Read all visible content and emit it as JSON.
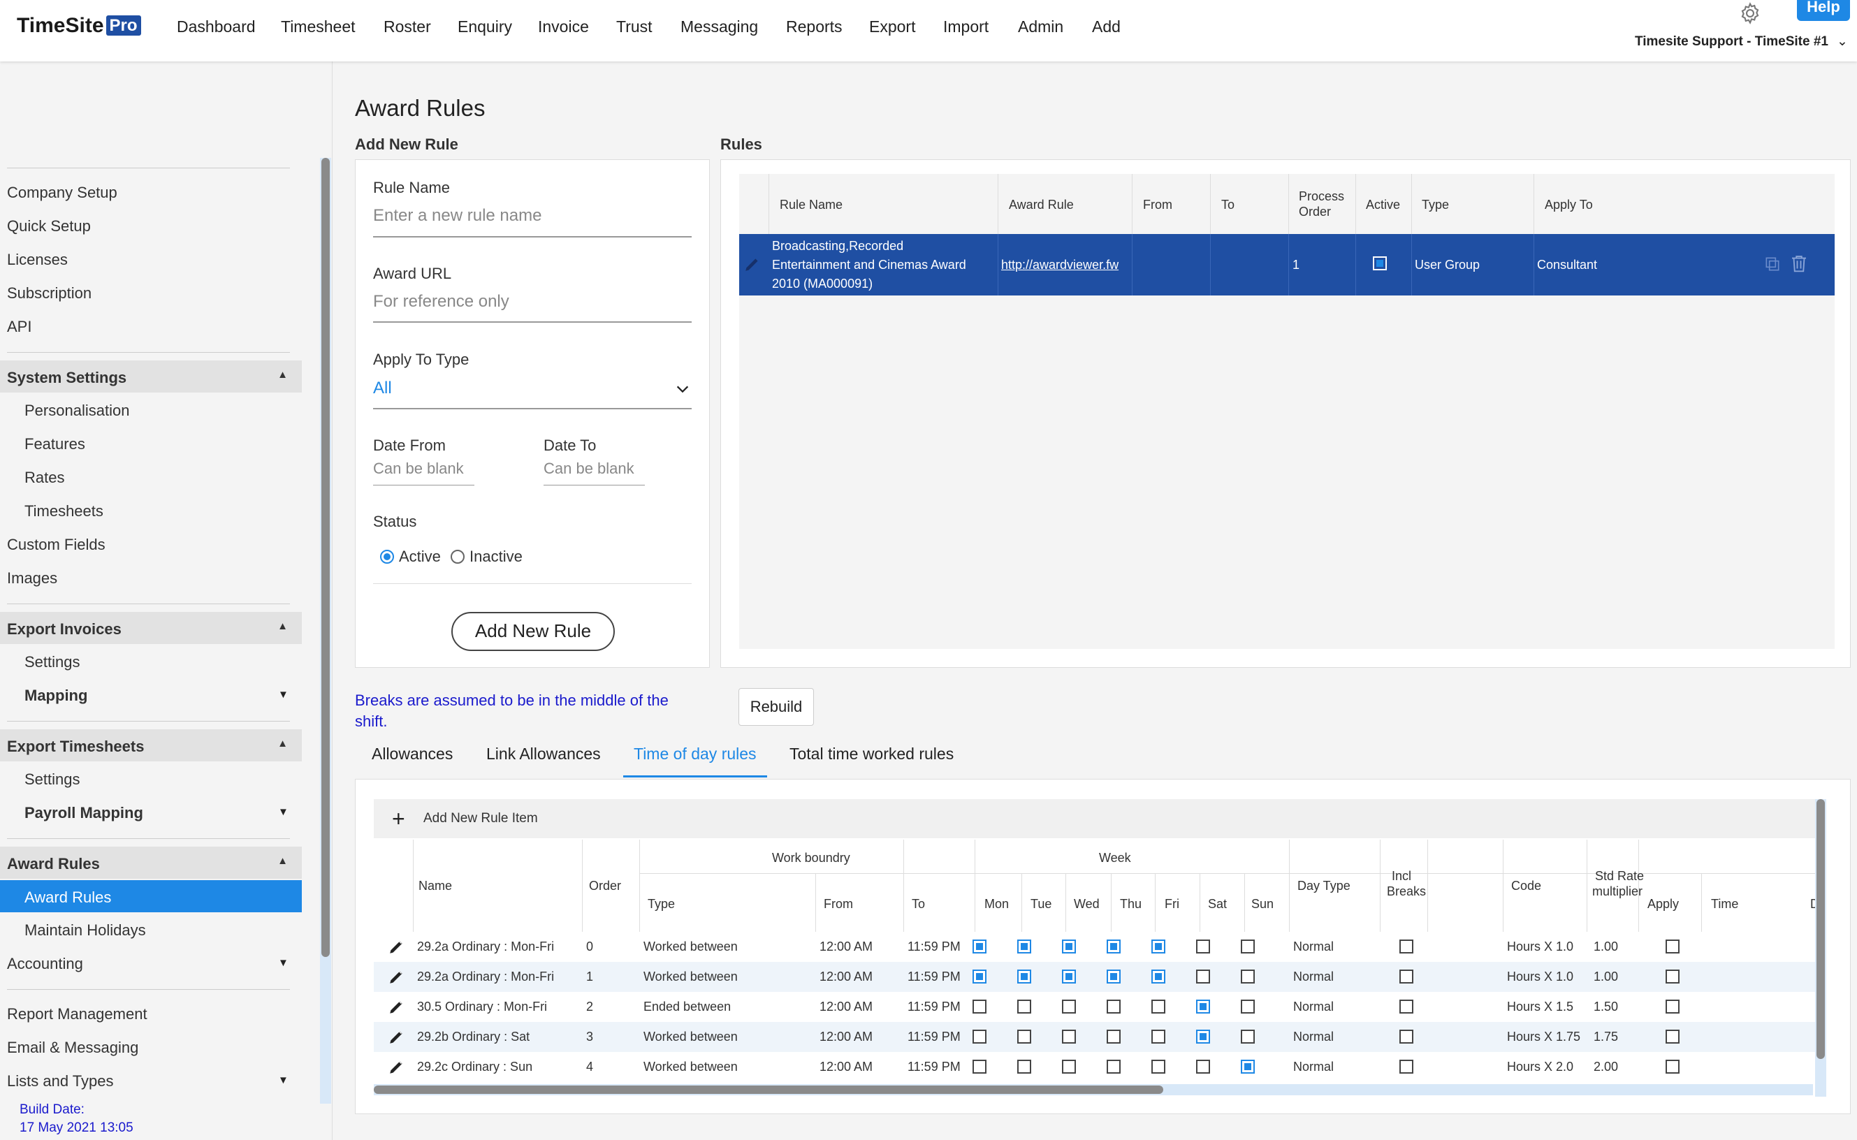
{
  "app": {
    "logo_text": "TimeSite",
    "logo_badge": "Pro",
    "help_label": "Help",
    "account": "Timesite Support - TimeSite #1"
  },
  "nav": [
    "Dashboard",
    "Timesheet",
    "Roster",
    "Enquiry",
    "Invoice",
    "Trust",
    "Messaging",
    "Reports",
    "Export",
    "Import",
    "Admin",
    "Add"
  ],
  "sidebar": {
    "group1": [
      "Company Setup",
      "Quick Setup",
      "Licenses",
      "Subscription",
      "API"
    ],
    "system_settings": {
      "title": "System Settings",
      "items": [
        "Personalisation",
        "Features",
        "Rates",
        "Timesheets"
      ]
    },
    "group2": [
      "Custom Fields",
      "Images"
    ],
    "export_invoices": {
      "title": "Export Invoices",
      "items": [
        "Settings",
        "Mapping"
      ]
    },
    "export_timesheets": {
      "title": "Export Timesheets",
      "items": [
        "Settings",
        "Payroll Mapping"
      ]
    },
    "award_rules": {
      "title": "Award Rules",
      "items": [
        "Award Rules",
        "Maintain Holidays"
      ]
    },
    "accounting": "Accounting",
    "group3": [
      "Report Management",
      "Email & Messaging",
      "Lists and Types"
    ],
    "build_label": "Build Date:",
    "build_date": "17 May 2021 13:05"
  },
  "page": {
    "title": "Award Rules",
    "add_new_rule": "Add New Rule",
    "rules": "Rules"
  },
  "form": {
    "rule_name_label": "Rule Name",
    "rule_name_ph": "Enter a new rule name",
    "award_url_label": "Award URL",
    "award_url_ph": "For reference only",
    "apply_type_label": "Apply To Type",
    "apply_type_value": "All",
    "date_from_label": "Date From",
    "date_from_ph": "Can be blank",
    "date_to_label": "Date To",
    "date_to_ph": "Can be blank",
    "status_label": "Status",
    "active": "Active",
    "inactive": "Inactive",
    "submit": "Add New Rule"
  },
  "rules_table": {
    "headers": {
      "name": "Rule Name",
      "award": "Award Rule",
      "from": "From",
      "to": "To",
      "order1": "Process",
      "order2": "Order",
      "active": "Active",
      "type": "Type",
      "apply": "Apply To"
    },
    "row": {
      "name1": "Broadcasting,Recorded",
      "name2": "Entertainment and Cinemas Award",
      "name3": "2010 (MA000091)",
      "award": "http://awardviewer.fw",
      "from": "",
      "to": "",
      "order": "1",
      "type": "User Group",
      "apply": "Consultant"
    }
  },
  "breaks_note1": "Breaks are assumed to be in the middle of the",
  "breaks_note2": "shift.",
  "rebuild": "Rebuild",
  "tabs": [
    "Allowances",
    "Link Allowances",
    "Time of day rules",
    "Total time worked rules"
  ],
  "items_table": {
    "add_item": "Add New Rule Item",
    "headers": {
      "name": "Name",
      "order": "Order",
      "work_boundry": "Work boundry",
      "week": "Week",
      "type": "Type",
      "from": "From",
      "to": "To",
      "mon": "Mon",
      "tue": "Tue",
      "wed": "Wed",
      "thu": "Thu",
      "fri": "Fri",
      "sat": "Sat",
      "sun": "Sun",
      "day_type": "Day Type",
      "incl1": "Incl",
      "incl2": "Breaks",
      "code": "Code",
      "std1": "Std Rate",
      "std2": "multiplier",
      "apply": "Apply",
      "time": "Time",
      "more": "D"
    },
    "rows": [
      {
        "name": "29.2a Ordinary : Mon-Fri",
        "order": "0",
        "type": "Worked between",
        "from": "12:00 AM",
        "to": "11:59 PM",
        "days": [
          1,
          1,
          1,
          1,
          1,
          0,
          0
        ],
        "day_type": "Normal",
        "code": "Hours X 1.0",
        "mult": "1.00"
      },
      {
        "name": "29.2a Ordinary : Mon-Fri",
        "order": "1",
        "type": "Worked between",
        "from": "12:00 AM",
        "to": "11:59 PM",
        "days": [
          1,
          1,
          1,
          1,
          1,
          0,
          0
        ],
        "day_type": "Normal",
        "code": "Hours X 1.0",
        "mult": "1.00"
      },
      {
        "name": "30.5 Ordinary : Mon-Fri",
        "order": "2",
        "type": "Ended between",
        "from": "12:00 AM",
        "to": "11:59 PM",
        "days": [
          0,
          0,
          0,
          0,
          0,
          1,
          0
        ],
        "day_type": "Normal",
        "code": "Hours X 1.5",
        "mult": "1.50"
      },
      {
        "name": "29.2b Ordinary : Sat",
        "order": "3",
        "type": "Worked between",
        "from": "12:00 AM",
        "to": "11:59 PM",
        "days": [
          0,
          0,
          0,
          0,
          0,
          1,
          0
        ],
        "day_type": "Normal",
        "code": "Hours X 1.75",
        "mult": "1.75"
      },
      {
        "name": "29.2c Ordinary : Sun",
        "order": "4",
        "type": "Worked between",
        "from": "12:00 AM",
        "to": "11:59 PM",
        "days": [
          0,
          0,
          0,
          0,
          0,
          0,
          1
        ],
        "day_type": "Normal",
        "code": "Hours X 2.0",
        "mult": "2.00"
      }
    ]
  },
  "colors": {
    "accent": "#1e88e5",
    "selected_row": "#1f4fa3",
    "link_note": "#1a1acc"
  }
}
